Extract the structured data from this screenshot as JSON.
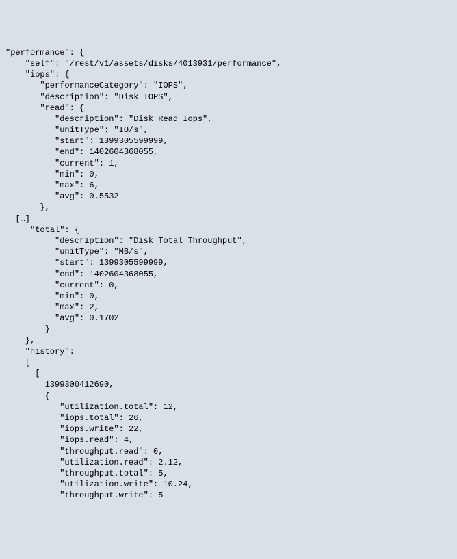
{
  "lines": [
    "\"performance\": {",
    "    \"self\": \"/rest/v1/assets/disks/4013931/performance\",",
    "    \"iops\": {",
    "       \"performanceCategory\": \"IOPS\",",
    "       \"description\": \"Disk IOPS\",",
    "       \"read\": {",
    "          \"description\": \"Disk Read Iops\",",
    "          \"unitType\": \"IO/s\",",
    "          \"start\": 1399305599999,",
    "          \"end\": 1402604368055,",
    "          \"current\": 1,",
    "          \"min\": 0,",
    "          \"max\": 6,",
    "          \"avg\": 0.5532",
    "       },",
    "  […]",
    "     \"total\": {",
    "          \"description\": \"Disk Total Throughput\",",
    "          \"unitType\": \"MB/s\",",
    "          \"start\": 1399305599999,",
    "          \"end\": 1402604368055,",
    "          \"current\": 0,",
    "          \"min\": 0,",
    "          \"max\": 2,",
    "          \"avg\": 0.1702",
    "        }",
    "    },",
    "    \"history\":",
    "    [",
    "      [",
    "        1399300412690,",
    "        {",
    "           \"utilization.total\": 12,",
    "           \"iops.total\": 26,",
    "           \"iops.write\": 22,",
    "           \"iops.read\": 4,",
    "           \"throughput.read\": 0,",
    "           \"utilization.read\": 2.12,",
    "           \"throughput.total\": 5,",
    "           \"utilization.write\": 10.24,",
    "           \"throughput.write\": 5"
  ]
}
